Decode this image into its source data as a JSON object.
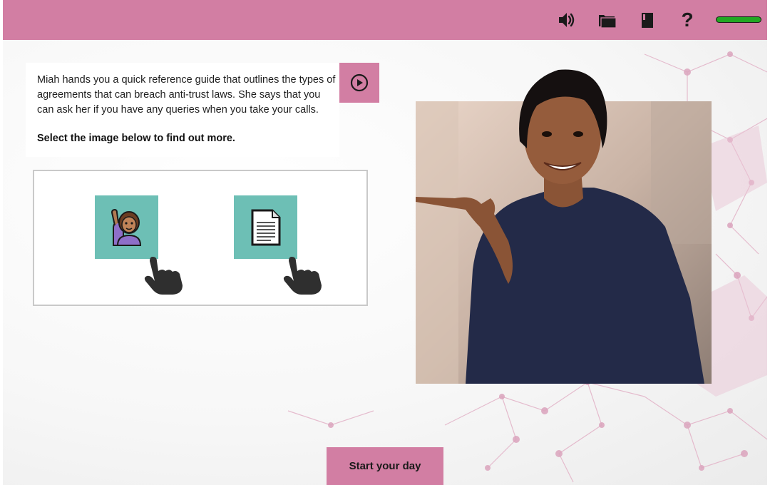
{
  "topbar": {
    "icons": [
      "speaker-icon",
      "folder-icon",
      "book-icon",
      "help-icon"
    ],
    "help_glyph": "?",
    "progress_fraction": 1.0,
    "progress_color": "#22a722"
  },
  "colors": {
    "accent": "#d27ea3",
    "tile": "#6dbfb5"
  },
  "intro": {
    "text": "Miah hands you a quick reference guide that outlines the types of agreements that can breach anti-trust laws. She says that you can ask her if you have any queries when you take your calls.",
    "instruction": "Select the image below to find out more."
  },
  "tiles": [
    {
      "icon": "person-raising-hand-icon"
    },
    {
      "icon": "document-icon"
    }
  ],
  "footer": {
    "start_label": "Start your day"
  }
}
